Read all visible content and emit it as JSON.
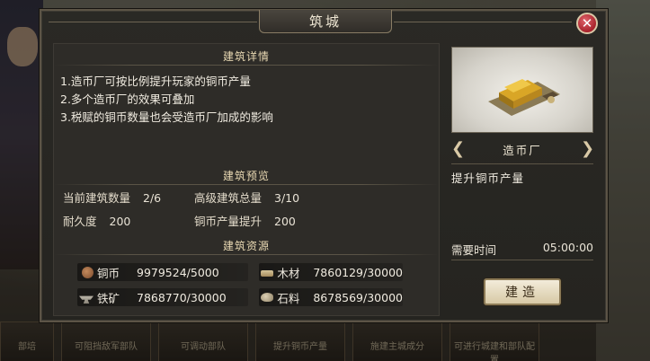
{
  "dialog": {
    "title": "筑城"
  },
  "details": {
    "title": "建筑详情",
    "lines": [
      "1.造币厂可按比例提升玩家的铜币产量",
      "2.多个造币厂的效果可叠加",
      "3.税赋的铜币数量也会受造币厂加成的影响"
    ]
  },
  "preview": {
    "title": "建筑预览",
    "current_count_label": "当前建筑数量",
    "current_count_value": "2/6",
    "advanced_total_label": "高级建筑总量",
    "advanced_total_value": "3/10",
    "durability_label": "耐久度",
    "durability_value": "200",
    "coin_boost_label": "铜币产量提升",
    "coin_boost_value": "200"
  },
  "resources": {
    "title": "建筑资源",
    "items": [
      {
        "name": "铜币",
        "value": "9979524/5000",
        "icon": "copper-coin-icon"
      },
      {
        "name": "木材",
        "value": "7860129/30000",
        "icon": "wood-icon"
      },
      {
        "name": "铁矿",
        "value": "7868770/30000",
        "icon": "iron-ore-icon"
      },
      {
        "name": "石料",
        "value": "8678569/30000",
        "icon": "stone-icon"
      }
    ]
  },
  "building": {
    "name": "造币厂",
    "description": "提升铜币产量",
    "time_label": "需要时间",
    "time_value": "05:00:00",
    "build_label": "建造",
    "icons": {
      "prev": "chevron-left-icon",
      "next": "chevron-right-icon"
    }
  },
  "background_cards": [
    "部培",
    "可阻挡敌军部队",
    "可调动部队",
    "提升铜币产量",
    "施建主城成分",
    "可进行城建和部队配置"
  ],
  "colors": {
    "dialog_bg": "#2a2925",
    "panel_border": "#5c5446",
    "title_text": "#efe7d4",
    "section_title": "#e9d9b3",
    "close_button": "#a8222c",
    "build_button": "#e8dfc6"
  }
}
